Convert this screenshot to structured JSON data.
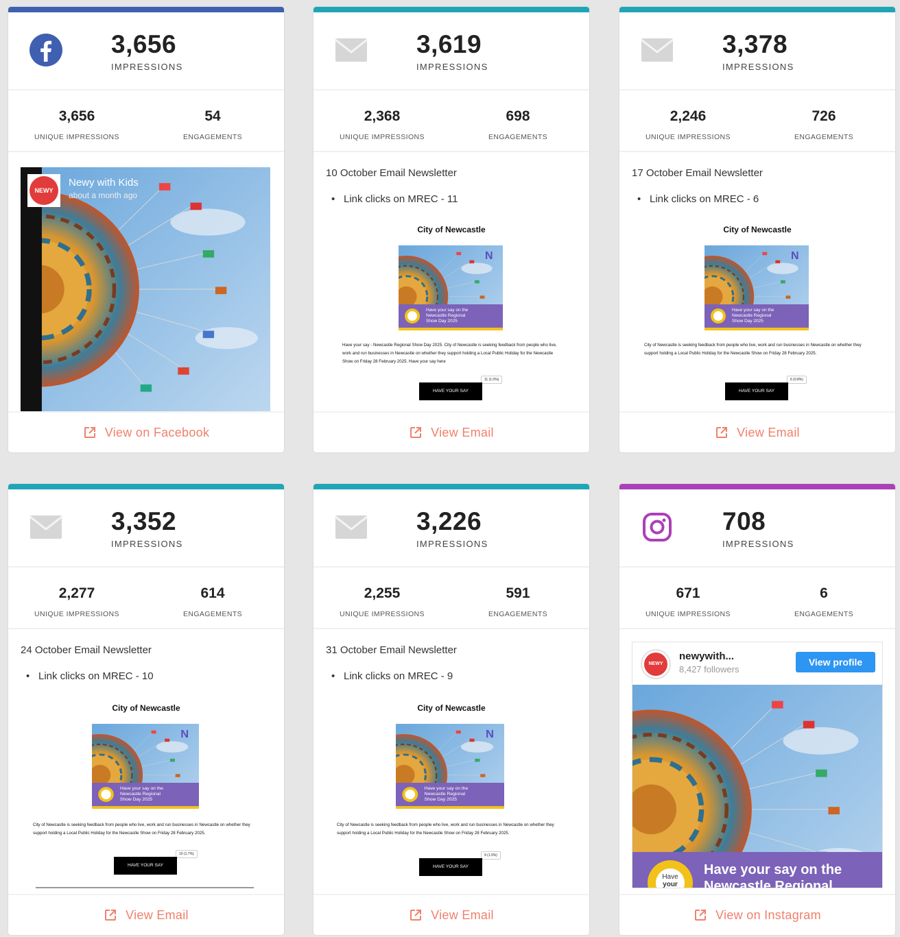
{
  "colors": {
    "facebook": "#3f5fb0",
    "email": "#1fa5b5",
    "instagram": "#ab3fb8",
    "link": "#f0806c",
    "button_blue": "#2d95f2"
  },
  "impressions_label": "IMPRESSIONS",
  "unique_label": "UNIQUE IMPRESSIONS",
  "engagements_label": "ENGAGEMENTS",
  "email_preview": {
    "city": "City of Newcastle",
    "banner": "Have your say on the Newcastle Regional Show Day 2025",
    "text_long": "Have your say - Newcastle Regional Show Day 2025. City of Newcastle is seeking feedback from people who live, work and run businesses in Newcastle on whether they support holding a Local Public Holiday for the Newcastle Show on Friday 28 February 2025. Have your say here",
    "text_short": "City of Newcastle is seeking feedback from people who live, work and run businesses in Newcastle on whether they support holding a Local Public Holiday for the Newcastle Show on Friday 28 February 2025.",
    "button": "HAVE YOUR SAY"
  },
  "cards": [
    {
      "type": "facebook",
      "impressions": "3,656",
      "unique": "3,656",
      "engagements": "54",
      "post": {
        "name": "Newy with Kids",
        "time": "about a month ago",
        "logo": "NEWY"
      },
      "link": "View on Facebook"
    },
    {
      "type": "email",
      "impressions": "3,619",
      "unique": "2,368",
      "engagements": "698",
      "title": "10 October Email Newsletter",
      "bullet": "Link clicks on MREC - 11",
      "badge": "11 (1.0%)",
      "link": "View Email"
    },
    {
      "type": "email",
      "impressions": "3,378",
      "unique": "2,246",
      "engagements": "726",
      "title": "17 October Email Newsletter",
      "bullet": "Link clicks on MREC - 6",
      "badge": "6 (0.8%)",
      "link": "View Email"
    },
    {
      "type": "email",
      "impressions": "3,352",
      "unique": "2,277",
      "engagements": "614",
      "title": "24 October Email Newsletter",
      "bullet": "Link clicks on MREC - 10",
      "badge": "10 (1.7%)",
      "link": "View Email"
    },
    {
      "type": "email",
      "impressions": "3,226",
      "unique": "2,255",
      "engagements": "591",
      "title": "31 October Email Newsletter",
      "bullet": "Link clicks on MREC - 9",
      "badge": "9 (1.5%)",
      "link": "View Email"
    },
    {
      "type": "instagram",
      "impressions": "708",
      "unique": "671",
      "engagements": "6",
      "post": {
        "handle": "newywith...",
        "followers": "8,427 followers",
        "button": "View profile",
        "banner_line1": "Have your say on the",
        "banner_line2": "Newcastle Regional",
        "badge1": "Have",
        "badge2": "your"
      },
      "link": "View on Instagram"
    }
  ]
}
